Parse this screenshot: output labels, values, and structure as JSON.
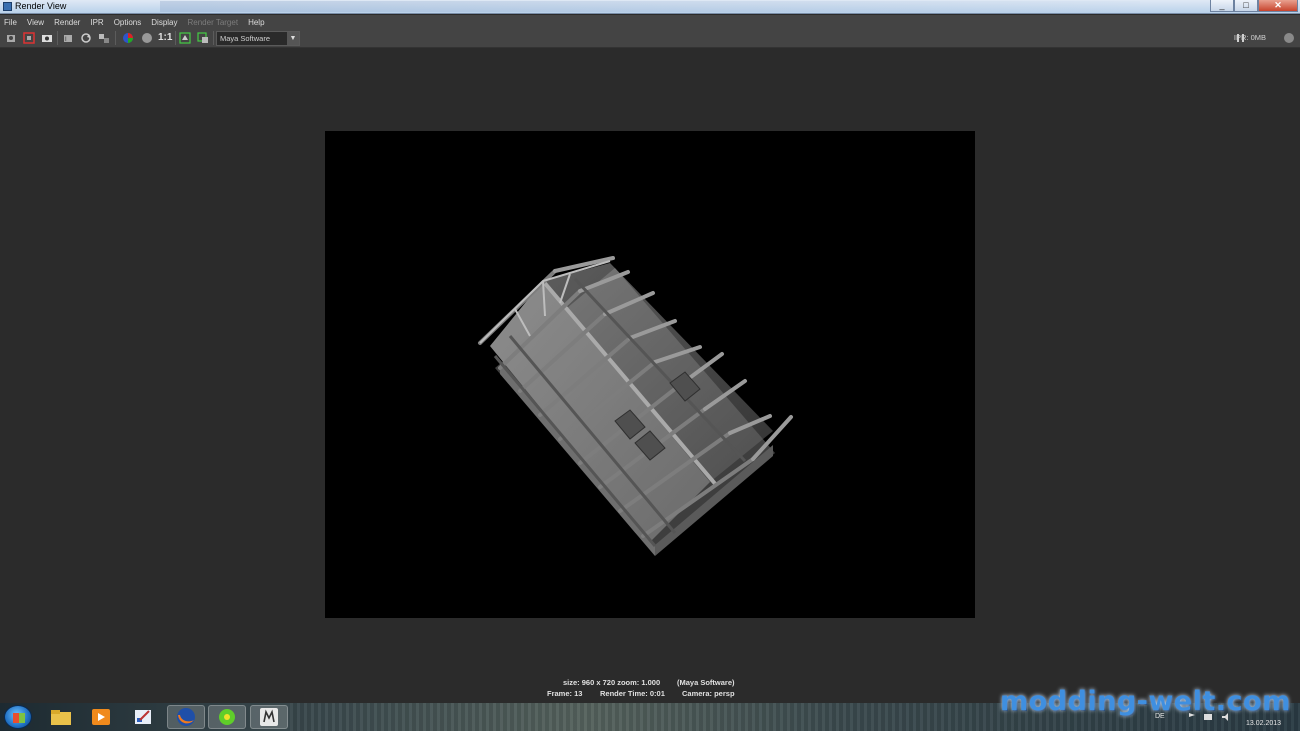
{
  "window": {
    "title": "Render View",
    "controls": [
      "minimize",
      "maximize",
      "close"
    ]
  },
  "menu": [
    "File",
    "View",
    "Render",
    "IPR",
    "Options",
    "Display",
    "Render Target",
    "Help"
  ],
  "menu_disabled": [
    "Render Target"
  ],
  "toolbar": {
    "one_to_one": "1:1",
    "renderer": "Maya Software",
    "ipr_status": "IPR: 0MB"
  },
  "render_info": {
    "line1_size": "size: 960 x 720 zoom: 1.000",
    "line1_renderer": "(Maya Software)",
    "line2_frame": "Frame: 13",
    "line2_time": "Render Time: 0:01",
    "line2_camera": "Camera: persp"
  },
  "taskbar": {
    "apps": [
      "windows-explorer",
      "media-player",
      "paint",
      "firefox",
      "icq",
      "maya"
    ],
    "active_app": "maya"
  },
  "tray": {
    "language": "DE",
    "date": "13.02.2013"
  },
  "watermark": "modding-welt.com",
  "colors": {
    "background": "#2b2b2b",
    "render_bg": "#000000",
    "model": "#8c8c8c",
    "accent_watermark": "#3f8fe0"
  }
}
